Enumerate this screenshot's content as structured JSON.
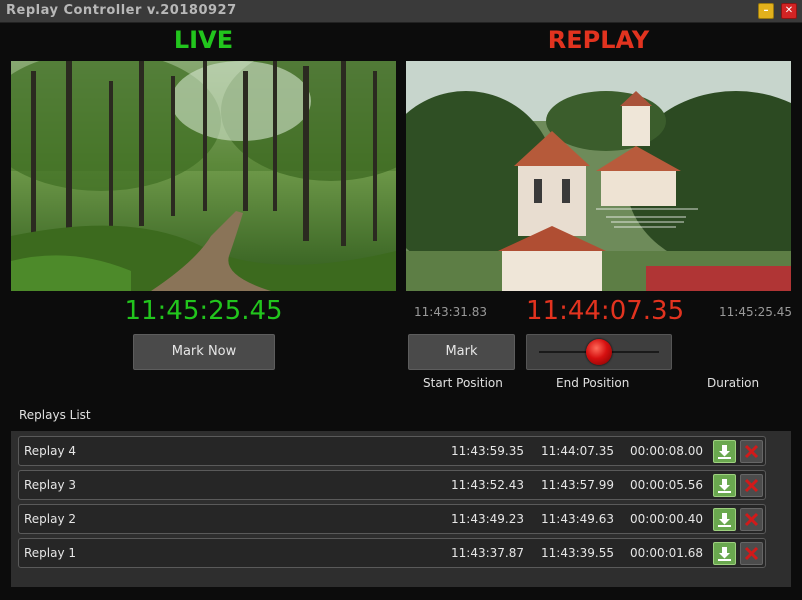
{
  "window": {
    "title": "Replay Controller v.20180927",
    "minimize_symbol": "–",
    "close_symbol": "✕"
  },
  "live": {
    "header": "LIVE",
    "time": "11:45:25.45",
    "mark_now_label": "Mark Now",
    "image_icon": "forest-path-image"
  },
  "replay": {
    "header": "REPLAY",
    "start_time": "11:43:31.83",
    "current_time": "11:44:07.35",
    "end_time": "11:45:25.45",
    "mark_label": "Mark",
    "slider_position": 0.5,
    "image_icon": "church-aerial-image",
    "start_position_label": "Start Position",
    "end_position_label": "End Position",
    "duration_label": "Duration"
  },
  "list": {
    "label": "Replays List",
    "rows": [
      {
        "name": "Replay 4",
        "start": "11:43:59.35",
        "end": "11:44:07.35",
        "duration": "00:00:08.00"
      },
      {
        "name": "Replay 3",
        "start": "11:43:52.43",
        "end": "11:43:57.99",
        "duration": "00:00:05.56"
      },
      {
        "name": "Replay 2",
        "start": "11:43:49.23",
        "end": "11:43:49.63",
        "duration": "00:00:00.40"
      },
      {
        "name": "Replay 1",
        "start": "11:43:37.87",
        "end": "11:43:39.55",
        "duration": "00:00:01.68"
      }
    ]
  },
  "colors": {
    "live_green": "#22c51d",
    "replay_red": "#e2331f",
    "download_green": "#6aa84f",
    "delete_red": "#cc1b1b"
  }
}
